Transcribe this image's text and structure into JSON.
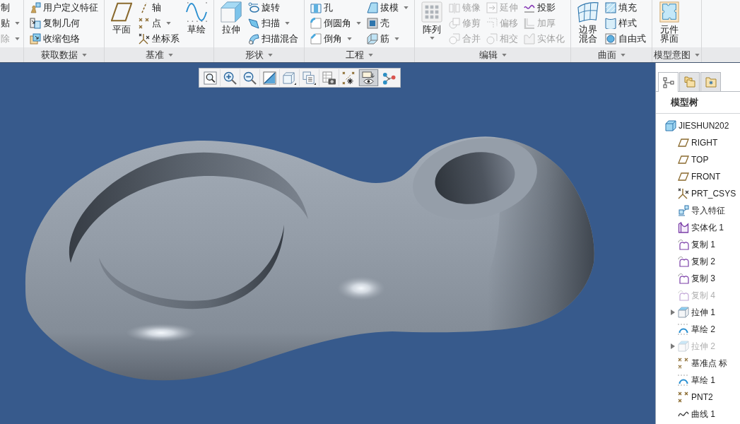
{
  "ribbon": {
    "groups": [
      {
        "columns": [
          {
            "kind": "stack",
            "items": [
              {
                "label": "制",
                "dropdown": false,
                "disabled": false
              },
              {
                "label": "贴",
                "dropdown": true,
                "disabled": false
              },
              {
                "label": "除",
                "dropdown": true,
                "disabled": true
              }
            ]
          }
        ]
      },
      {
        "label": "获取数据",
        "columns": [
          {
            "kind": "stack",
            "items": [
              {
                "label": "用户定义特征",
                "dropdown": false,
                "disabled": false
              },
              {
                "label": "复制几何",
                "dropdown": false,
                "disabled": false
              },
              {
                "label": "收缩包络",
                "dropdown": false,
                "disabled": false
              }
            ]
          }
        ]
      },
      {
        "label": "基准",
        "columns": [
          {
            "kind": "large",
            "label": "平面",
            "dropdown": false,
            "disabled": false
          },
          {
            "kind": "stack",
            "items": [
              {
                "label": "轴",
                "dropdown": false,
                "disabled": false
              },
              {
                "label": "点",
                "dropdown": true,
                "disabled": false
              },
              {
                "label": "坐标系",
                "dropdown": false,
                "disabled": false
              }
            ]
          },
          {
            "kind": "large",
            "label": "草绘",
            "dropdown": false,
            "disabled": false
          }
        ]
      },
      {
        "label": "形状",
        "columns": [
          {
            "kind": "large",
            "label": "拉伸",
            "dropdown": false,
            "disabled": false
          },
          {
            "kind": "stack",
            "items": [
              {
                "label": "旋转",
                "dropdown": false,
                "disabled": false
              },
              {
                "label": "扫描",
                "dropdown": true,
                "disabled": false
              },
              {
                "label": "扫描混合",
                "dropdown": false,
                "disabled": false
              }
            ]
          }
        ]
      },
      {
        "label": "工程",
        "columns": [
          {
            "kind": "stack",
            "items": [
              {
                "label": "孔",
                "dropdown": false,
                "disabled": false
              },
              {
                "label": "倒圆角",
                "dropdown": true,
                "disabled": false
              },
              {
                "label": "倒角",
                "dropdown": true,
                "disabled": false
              }
            ]
          },
          {
            "kind": "stack",
            "items": [
              {
                "label": "拔模",
                "dropdown": true,
                "disabled": false
              },
              {
                "label": "壳",
                "dropdown": false,
                "disabled": false
              },
              {
                "label": "筋",
                "dropdown": true,
                "disabled": false
              }
            ]
          }
        ]
      },
      {
        "label": "编辑",
        "columns": [
          {
            "kind": "large",
            "label": "阵列",
            "dropdown": true,
            "disabled": false
          },
          {
            "kind": "stack",
            "items": [
              {
                "label": "镜像",
                "dropdown": false,
                "disabled": true
              },
              {
                "label": "修剪",
                "dropdown": false,
                "disabled": true
              },
              {
                "label": "合并",
                "dropdown": false,
                "disabled": true
              }
            ]
          },
          {
            "kind": "stack",
            "items": [
              {
                "label": "延伸",
                "dropdown": false,
                "disabled": true
              },
              {
                "label": "偏移",
                "dropdown": false,
                "disabled": true
              },
              {
                "label": "相交",
                "dropdown": false,
                "disabled": true
              }
            ]
          },
          {
            "kind": "stack",
            "items": [
              {
                "label": "投影",
                "dropdown": false,
                "disabled": false
              },
              {
                "label": "加厚",
                "dropdown": false,
                "disabled": true
              },
              {
                "label": "实体化",
                "dropdown": false,
                "disabled": true
              }
            ]
          }
        ]
      },
      {
        "label": "曲面",
        "columns": [
          {
            "kind": "large",
            "label": "边界混合",
            "dropdown": false,
            "disabled": false
          },
          {
            "kind": "stack",
            "items": [
              {
                "label": "填充",
                "dropdown": false,
                "disabled": false
              },
              {
                "label": "样式",
                "dropdown": false,
                "disabled": false
              },
              {
                "label": "自由式",
                "dropdown": false,
                "disabled": false
              }
            ]
          }
        ]
      },
      {
        "label": "模型意图",
        "columns": [
          {
            "kind": "large",
            "label": "元件界面",
            "dropdown": false,
            "disabled": false
          }
        ]
      }
    ]
  },
  "view_toolbar": {
    "buttons": [
      {
        "selected": false
      },
      {
        "selected": false
      },
      {
        "selected": false
      },
      {
        "selected": false
      },
      {
        "selected": false
      },
      {
        "selected": false
      },
      {
        "selected": false
      },
      {
        "selected": false
      },
      {
        "selected": true
      },
      {
        "selected": false
      }
    ]
  },
  "model_tree": {
    "tabs": [
      {
        "selected": true
      },
      {
        "selected": false
      },
      {
        "selected": false
      }
    ],
    "title": "模型树",
    "items": [
      {
        "label": "JIESHUN202",
        "kind": "part",
        "collapsed": false,
        "disabled": false,
        "children": [
          {
            "label": "RIGHT",
            "kind": "plane",
            "collapsed": false,
            "disabled": false
          },
          {
            "label": "TOP",
            "kind": "plane",
            "collapsed": false,
            "disabled": false
          },
          {
            "label": "FRONT",
            "kind": "plane",
            "collapsed": false,
            "disabled": false
          },
          {
            "label": "PRT_CSYS",
            "kind": "csys",
            "collapsed": false,
            "disabled": false
          },
          {
            "label": "导入特征",
            "kind": "import",
            "collapsed": false,
            "disabled": false
          },
          {
            "label": "实体化 1",
            "kind": "solidify",
            "collapsed": false,
            "disabled": false
          },
          {
            "label": "复制 1",
            "kind": "copy",
            "collapsed": false,
            "disabled": false
          },
          {
            "label": "复制 2",
            "kind": "copy",
            "collapsed": false,
            "disabled": false
          },
          {
            "label": "复制 3",
            "kind": "copy",
            "collapsed": false,
            "disabled": false
          },
          {
            "label": "复制 4",
            "kind": "copy",
            "collapsed": false,
            "disabled": true
          },
          {
            "label": "拉伸 1",
            "kind": "extrude",
            "collapsed": true,
            "disabled": false
          },
          {
            "label": "草绘 2",
            "kind": "sketch",
            "collapsed": false,
            "disabled": false
          },
          {
            "label": "拉伸 2",
            "kind": "extrude",
            "collapsed": true,
            "disabled": true
          },
          {
            "label": "基准点 标",
            "kind": "point",
            "collapsed": false,
            "disabled": false
          },
          {
            "label": "草绘 1",
            "kind": "sketch",
            "collapsed": false,
            "disabled": false
          },
          {
            "label": "PNT2",
            "kind": "point",
            "collapsed": false,
            "disabled": false
          },
          {
            "label": "曲线 1",
            "kind": "curve",
            "collapsed": false,
            "disabled": false
          }
        ]
      }
    ]
  }
}
